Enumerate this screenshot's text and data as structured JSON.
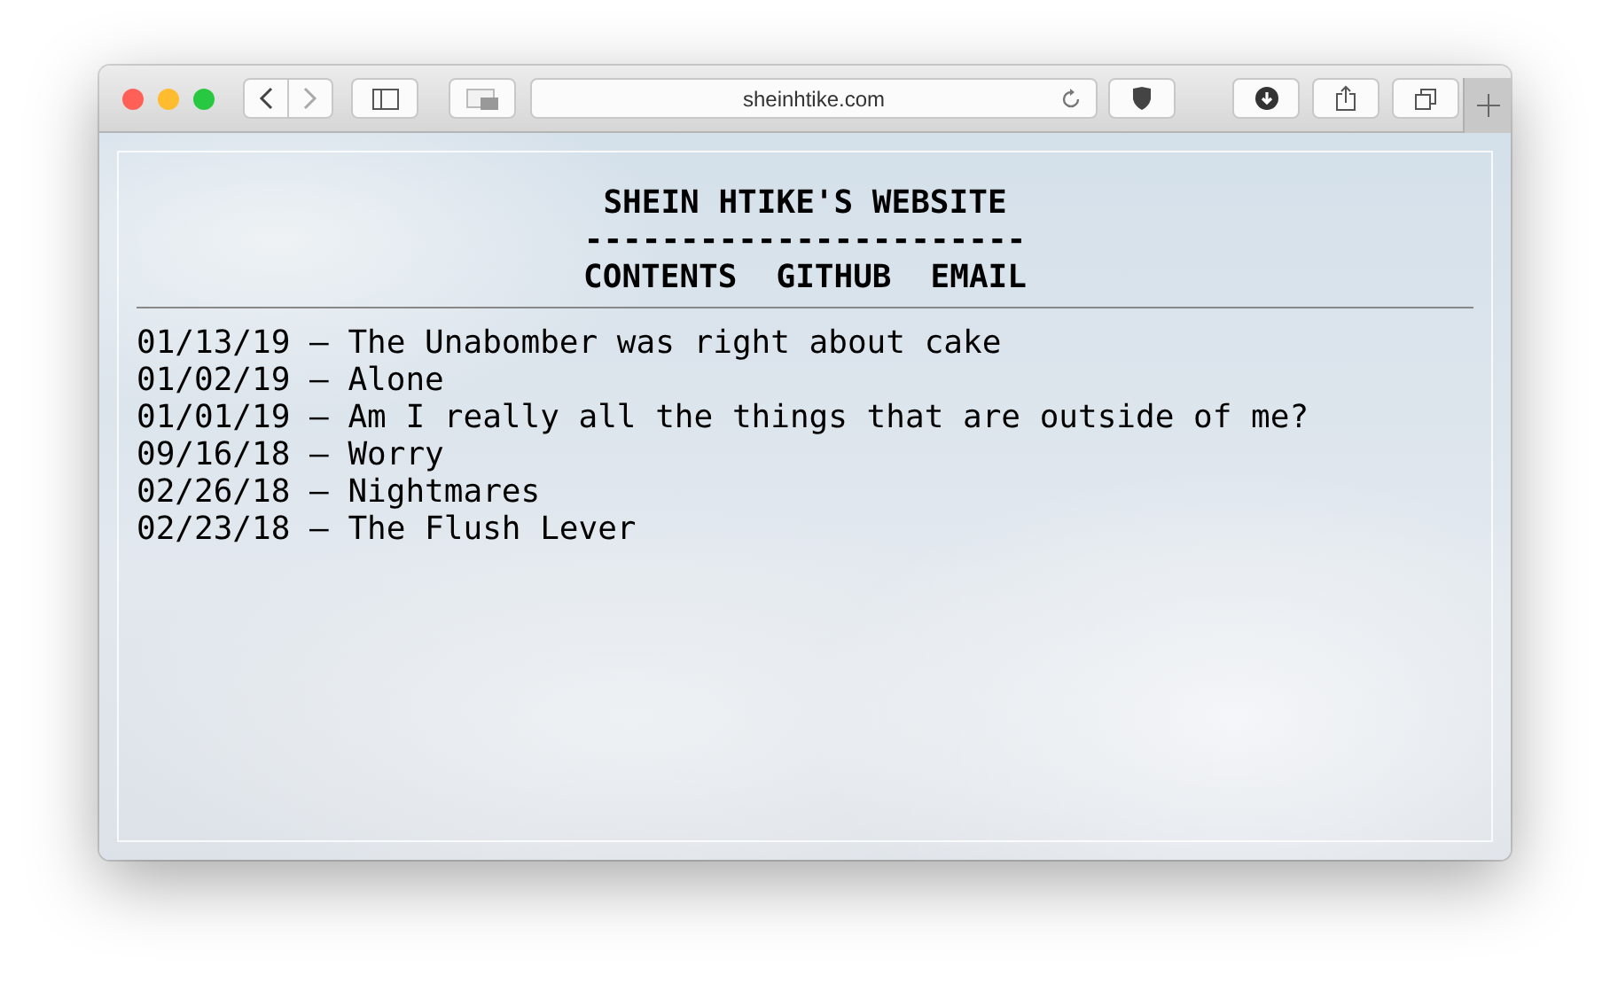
{
  "browser": {
    "address": "sheinhtike.com"
  },
  "site": {
    "title": "SHEIN HTIKE'S WEBSITE",
    "rule": "-----------------------",
    "nav": [
      "CONTENTS",
      "GITHUB",
      "EMAIL"
    ],
    "posts": [
      {
        "text": "01/13/19 – The Unabomber was right about cake"
      },
      {
        "text": "01/02/19 – Alone"
      },
      {
        "text": "01/01/19 – Am I really all the things that are outside of me?"
      },
      {
        "text": "09/16/18 – Worry"
      },
      {
        "text": "02/26/18 – Nightmares"
      },
      {
        "text": "02/23/18 – The Flush Lever"
      }
    ]
  }
}
